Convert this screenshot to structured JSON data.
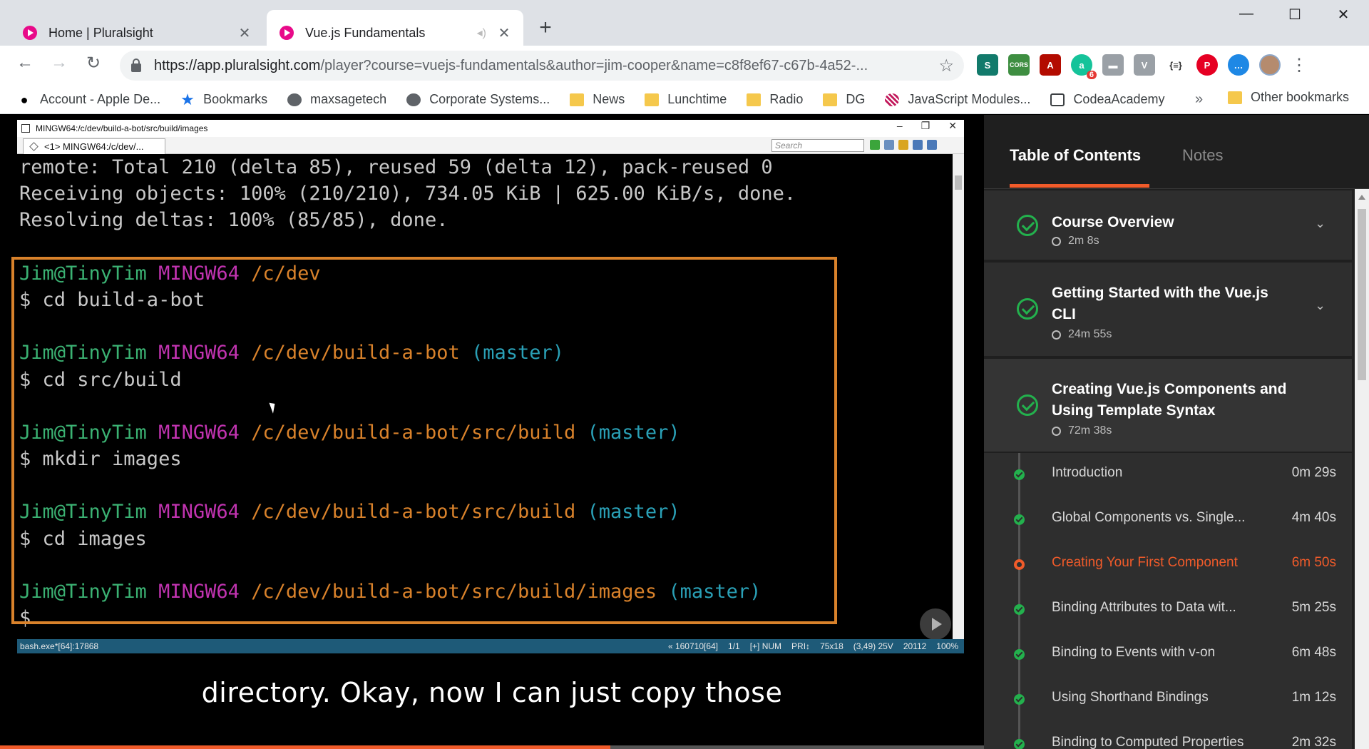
{
  "browser": {
    "tabs": [
      {
        "title": "Home | Pluralsight",
        "active": false
      },
      {
        "title": "Vue.js Fundamentals",
        "active": true
      }
    ],
    "url_host": "https://app.pluralsight.com",
    "url_path": "/player?course=vuejs-fundamentals&author=jim-cooper&name=c8f8ef67-c67b-4a52-...",
    "extensions": [
      {
        "name": "stylus-icon",
        "label": "S",
        "color": "#127a6b"
      },
      {
        "name": "cors-icon",
        "label": "CORS",
        "color": "#3e8e41"
      },
      {
        "name": "pdf-icon",
        "label": "A",
        "color": "#b30b00"
      },
      {
        "name": "grammarly-icon",
        "label": "a",
        "color": "#15c39a",
        "badge": "6"
      },
      {
        "name": "comment-icon",
        "label": "▬",
        "color": "#9aa0a6"
      },
      {
        "name": "vuetools-icon",
        "label": "V",
        "color": "#9aa0a6"
      },
      {
        "name": "json-icon",
        "label": "{≡}",
        "color": "#ffffff"
      },
      {
        "name": "pinterest-icon",
        "label": "P",
        "color": "#e60023"
      },
      {
        "name": "messenger-icon",
        "label": "…",
        "color": "#1e88e5"
      }
    ],
    "bookmarks": [
      {
        "label": "Account - Apple De...",
        "icon": "apple-icon"
      },
      {
        "label": "Bookmarks",
        "icon": "star-icon"
      },
      {
        "label": "maxsagetech",
        "icon": "globe-icon"
      },
      {
        "label": "Corporate Systems...",
        "icon": "globe-icon"
      },
      {
        "label": "News",
        "icon": "folder-icon"
      },
      {
        "label": "Lunchtime",
        "icon": "folder-icon"
      },
      {
        "label": "Radio",
        "icon": "folder-icon"
      },
      {
        "label": "DG",
        "icon": "folder-icon"
      },
      {
        "label": "JavaScript Modules...",
        "icon": "pattern-icon"
      },
      {
        "label": "CodeaAcademy",
        "icon": "codea-icon"
      }
    ],
    "other_bookmarks": "Other bookmarks",
    "more_chevron": "»"
  },
  "terminal": {
    "window_title": "MINGW64:/c/dev/build-a-bot/src/build/images",
    "tab_label": "<1> MINGW64:/c/dev/...",
    "search_placeholder": "Search",
    "lines": [
      [
        {
          "t": "remote: Total 210 (delta 85), reused 59 (delta 12), pack-reused 0",
          "c": ""
        }
      ],
      [
        {
          "t": "Receiving objects: 100% (210/210), 734.05 KiB | 625.00 KiB/s, done.",
          "c": ""
        }
      ],
      [
        {
          "t": "Resolving deltas: 100% (85/85), done.",
          "c": ""
        }
      ],
      [
        {
          "t": "",
          "c": ""
        }
      ],
      [
        {
          "t": "Jim@TinyTim",
          "c": "user"
        },
        {
          "t": " ",
          "c": ""
        },
        {
          "t": "MINGW64",
          "c": "host"
        },
        {
          "t": " /c/dev",
          "c": "path"
        }
      ],
      [
        {
          "t": "$ cd build-a-bot",
          "c": ""
        }
      ],
      [
        {
          "t": "",
          "c": ""
        }
      ],
      [
        {
          "t": "Jim@TinyTim",
          "c": "user"
        },
        {
          "t": " ",
          "c": ""
        },
        {
          "t": "MINGW64",
          "c": "host"
        },
        {
          "t": " /c/dev/build-a-bot",
          "c": "path"
        },
        {
          "t": " (master)",
          "c": "branch"
        }
      ],
      [
        {
          "t": "$ cd src/build",
          "c": ""
        }
      ],
      [
        {
          "t": "",
          "c": ""
        }
      ],
      [
        {
          "t": "Jim@TinyTim",
          "c": "user"
        },
        {
          "t": " ",
          "c": ""
        },
        {
          "t": "MINGW64",
          "c": "host"
        },
        {
          "t": " /c/dev/build-a-bot/src/build",
          "c": "path"
        },
        {
          "t": " (master)",
          "c": "branch"
        }
      ],
      [
        {
          "t": "$ mkdir images",
          "c": ""
        }
      ],
      [
        {
          "t": "",
          "c": ""
        }
      ],
      [
        {
          "t": "Jim@TinyTim",
          "c": "user"
        },
        {
          "t": " ",
          "c": ""
        },
        {
          "t": "MINGW64",
          "c": "host"
        },
        {
          "t": " /c/dev/build-a-bot/src/build",
          "c": "path"
        },
        {
          "t": " (master)",
          "c": "branch"
        }
      ],
      [
        {
          "t": "$ cd images",
          "c": ""
        }
      ],
      [
        {
          "t": "",
          "c": ""
        }
      ],
      [
        {
          "t": "Jim@TinyTim",
          "c": "user"
        },
        {
          "t": " ",
          "c": ""
        },
        {
          "t": "MINGW64",
          "c": "host"
        },
        {
          "t": " /c/dev/build-a-bot/src/build/images",
          "c": "path"
        },
        {
          "t": " (master)",
          "c": "branch"
        }
      ],
      [
        {
          "t": "$",
          "c": ""
        }
      ]
    ],
    "status_left": "bash.exe*[64]:17868",
    "status_right": [
      "« 160710[64]",
      "1/1",
      "[+] NUM",
      "PRI↕",
      "75x18",
      "(3,49) 25V",
      "20112",
      "100%"
    ]
  },
  "video": {
    "caption": "directory. Okay, now I can just copy those",
    "progress": 0.62
  },
  "sidebar": {
    "tabs": {
      "toc": "Table of Contents",
      "notes": "Notes"
    },
    "modules": [
      {
        "title": "Course Overview",
        "duration": "2m 8s",
        "completed": true,
        "expanded": false
      },
      {
        "title": "Getting Started with the Vue.js CLI",
        "duration": "24m 55s",
        "completed": true,
        "expanded": false
      },
      {
        "title": "Creating Vue.js Components and Using Template Syntax",
        "duration": "72m 38s",
        "completed": true,
        "expanded": true
      }
    ],
    "clips": [
      {
        "title": "Introduction",
        "duration": "0m 29s",
        "status": "done"
      },
      {
        "title": "Global Components vs. Single...",
        "duration": "4m 40s",
        "status": "done"
      },
      {
        "title": "Creating Your First Component",
        "duration": "6m 50s",
        "status": "current"
      },
      {
        "title": "Binding Attributes to Data wit...",
        "duration": "5m 25s",
        "status": "done"
      },
      {
        "title": "Binding to Events with v-on",
        "duration": "6m 48s",
        "status": "done"
      },
      {
        "title": "Using Shorthand Bindings",
        "duration": "1m 12s",
        "status": "done"
      },
      {
        "title": "Binding to Computed Properties",
        "duration": "2m 32s",
        "status": "done"
      }
    ]
  },
  "colors": {
    "pluralsight_orange": "#f15b2a",
    "complete_green": "#23b14d",
    "highlight_box": "#d9822b"
  }
}
